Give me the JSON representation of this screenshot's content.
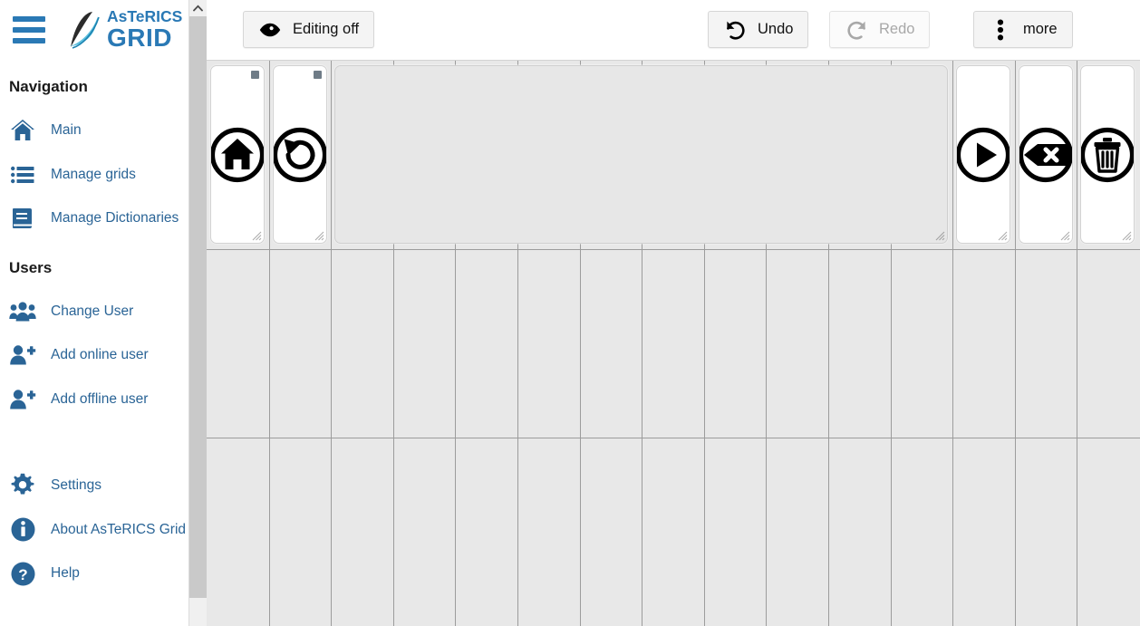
{
  "app": {
    "logo_top": "AsTeRICS",
    "logo_bottom": "GRID",
    "menu_icon": "hamburger-icon"
  },
  "sidebar": {
    "sections": [
      {
        "title": "Navigation",
        "items": [
          {
            "label": "Main",
            "icon": "home-icon"
          },
          {
            "label": "Manage grids",
            "icon": "list-icon"
          },
          {
            "label": "Manage Dictionaries",
            "icon": "book-icon"
          }
        ]
      },
      {
        "title": "Users",
        "items": [
          {
            "label": "Change User",
            "icon": "users-icon"
          },
          {
            "label": "Add online user",
            "icon": "user-plus-icon"
          },
          {
            "label": "Add offline user",
            "icon": "user-plus-icon"
          }
        ]
      }
    ],
    "footer_items": [
      {
        "label": "Settings",
        "icon": "gear-icon"
      },
      {
        "label": "About AsTeRICS Grid",
        "icon": "info-circle-icon"
      },
      {
        "label": "Help",
        "icon": "question-circle-icon"
      }
    ],
    "scrollbar": {
      "up_arrow": "chevron-up-icon"
    }
  },
  "toolbar": {
    "editing_label": "Editing off",
    "editing_icon": "eye-icon",
    "undo_label": "Undo",
    "undo_icon": "undo-arrow-icon",
    "undo_disabled": false,
    "redo_label": "Redo",
    "redo_icon": "redo-arrow-icon",
    "redo_disabled": true,
    "more_label": "more",
    "more_icon": "vertical-dots-icon"
  },
  "grid": {
    "columns": 15,
    "rows": 4,
    "cells": [
      {
        "name": "grid-cell-home",
        "icon": "circled-home-icon",
        "col": 0,
        "span": 1,
        "type": "action",
        "corner_mark": true
      },
      {
        "name": "grid-cell-back",
        "icon": "circled-back-arrow-icon",
        "col": 1,
        "span": 1,
        "type": "action",
        "corner_mark": true
      },
      {
        "name": "grid-cell-collect",
        "icon": "",
        "col": 2,
        "span": 10,
        "type": "collect",
        "corner_mark": false
      },
      {
        "name": "grid-cell-speak",
        "icon": "circled-play-icon",
        "col": 12,
        "span": 1,
        "type": "action",
        "corner_mark": false
      },
      {
        "name": "grid-cell-backspace",
        "icon": "circled-backspace-icon",
        "col": 13,
        "span": 1,
        "type": "action",
        "corner_mark": false
      },
      {
        "name": "grid-cell-clear",
        "icon": "circled-trash-icon",
        "col": 14,
        "span": 1,
        "type": "action",
        "corner_mark": false
      }
    ]
  },
  "colors": {
    "brand_blue": "#2a79b5",
    "link_blue": "#2a6496",
    "grid_bg": "#e8e8e8",
    "grid_line": "#9c9c9c",
    "cell_bg": "#ffffff",
    "collect_bg": "#e7e7e7",
    "toolbar_btn_bg": "#f4f4f4"
  }
}
